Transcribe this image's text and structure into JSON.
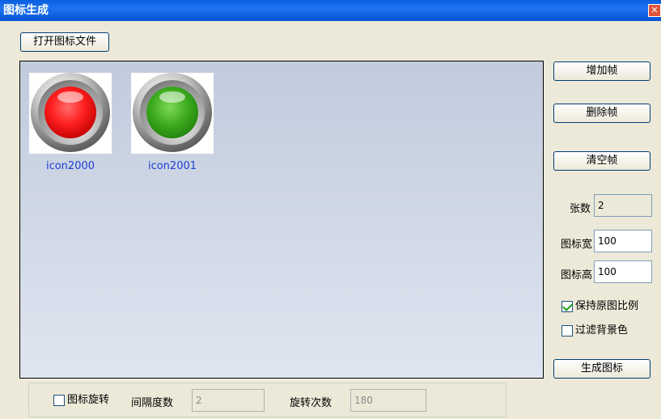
{
  "window": {
    "title": "图标生成",
    "close_glyph": "✕"
  },
  "toolbar": {
    "open_file_label": "打开图标文件"
  },
  "icons": [
    {
      "name": "icon2000",
      "color": "#ff2020"
    },
    {
      "name": "icon2001",
      "color": "#3aa81c"
    }
  ],
  "side": {
    "add_frame_label": "增加帧",
    "delete_frame_label": "删除帧",
    "clear_frame_label": "清空帧",
    "count_label": "张数",
    "count_value": "2",
    "width_label": "图标宽",
    "width_value": "100",
    "height_label": "图标高",
    "height_value": "100",
    "keep_ratio_label": "保持原图比例",
    "keep_ratio_checked": true,
    "filter_bg_label": "过滤背景色",
    "filter_bg_checked": false,
    "generate_label": "生成图标"
  },
  "rotation": {
    "rotate_label": "图标旋转",
    "rotate_checked": false,
    "interval_label": "间隔度数",
    "interval_value": "2",
    "times_label": "旋转次数",
    "times_value": "180"
  }
}
